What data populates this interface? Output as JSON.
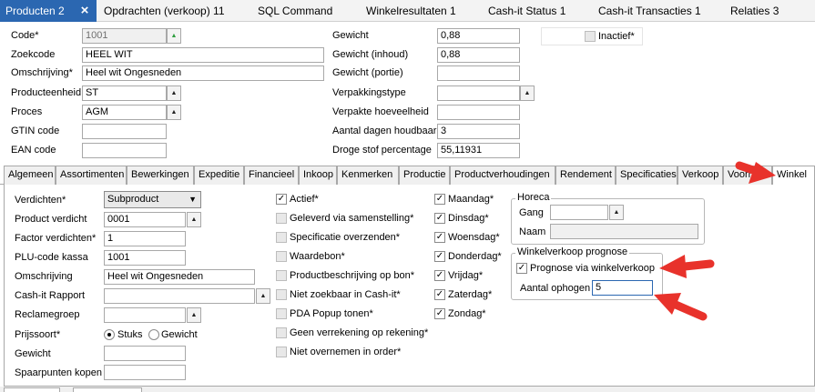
{
  "top_tabs": [
    {
      "label": "Producten 2",
      "active": true
    },
    {
      "label": "Opdrachten (verkoop) 11"
    },
    {
      "label": "SQL Command"
    },
    {
      "label": "Winkelresultaten 1"
    },
    {
      "label": "Cash-it Status 1"
    },
    {
      "label": "Cash-it Transacties 1"
    },
    {
      "label": "Relaties 3"
    }
  ],
  "close_icon": "×",
  "form": {
    "code": {
      "label": "Code*",
      "value": "1001"
    },
    "zoekcode": {
      "label": "Zoekcode",
      "value": "HEEL WIT"
    },
    "omschrijving": {
      "label": "Omschrijving*",
      "value": "Heel wit Ongesneden"
    },
    "producteenheid": {
      "label": "Producteenheid",
      "value": "ST"
    },
    "proces": {
      "label": "Proces",
      "value": "AGM"
    },
    "gtin": {
      "label": "GTIN code",
      "value": ""
    },
    "ean": {
      "label": "EAN code",
      "value": ""
    },
    "gewicht": {
      "label": "Gewicht",
      "value": "0,88"
    },
    "gewicht_inhoud": {
      "label": "Gewicht (inhoud)",
      "value": "0,88"
    },
    "gewicht_portie": {
      "label": "Gewicht (portie)",
      "value": ""
    },
    "verpakkingstype": {
      "label": "Verpakkingstype",
      "value": ""
    },
    "verpakte_hoeveelheid": {
      "label": "Verpakte hoeveelheid",
      "value": ""
    },
    "houdbaar": {
      "label": "Aantal dagen houdbaar",
      "value": "3"
    },
    "droge_stof": {
      "label": "Droge stof percentage",
      "value": "55,11931"
    },
    "inactief": {
      "label": "Inactief*",
      "checked": false
    }
  },
  "sub_tabs": [
    "Algemeen",
    "Assortimenten",
    "Bewerkingen",
    "Expeditie",
    "Financieel",
    "Inkoop",
    "Kenmerken",
    "Productie",
    "Productverhoudingen",
    "Rendement",
    "Specificaties",
    "Verkoop",
    "Voorraad",
    "Winkel"
  ],
  "active_sub_tab": "Winkel",
  "winkel": {
    "verdichten": {
      "label": "Verdichten*",
      "value": "Subproduct"
    },
    "product_verdicht": {
      "label": "Product verdicht",
      "value": "0001"
    },
    "factor_verdichten": {
      "label": "Factor verdichten*",
      "value": "1"
    },
    "plu": {
      "label": "PLU-code kassa",
      "value": "1001"
    },
    "omschrijving": {
      "label": "Omschrijving",
      "value": "Heel wit Ongesneden"
    },
    "cashit_rapport": {
      "label": "Cash-it Rapport",
      "value": ""
    },
    "reclamegroep": {
      "label": "Reclamegroep",
      "value": ""
    },
    "prijssoort": {
      "label": "Prijssoort*",
      "option_stuks": "Stuks",
      "option_gewicht": "Gewicht",
      "selected": "Stuks"
    },
    "gewicht": {
      "label": "Gewicht",
      "value": ""
    },
    "spaarpunten": {
      "label": "Spaarpunten kopen",
      "value": ""
    },
    "checks": [
      {
        "label": "Actief*",
        "checked": true,
        "enabled": true
      },
      {
        "label": "Geleverd via samenstelling*",
        "checked": false,
        "enabled": false
      },
      {
        "label": "Specificatie overzenden*",
        "checked": false,
        "enabled": false
      },
      {
        "label": "Waardebon*",
        "checked": false,
        "enabled": false
      },
      {
        "label": "Productbeschrijving op bon*",
        "checked": false,
        "enabled": false
      },
      {
        "label": "Niet zoekbaar in Cash-it*",
        "checked": false,
        "enabled": false
      },
      {
        "label": "PDA Popup tonen*",
        "checked": false,
        "enabled": false
      },
      {
        "label": "Geen verrekening op rekening*",
        "checked": false,
        "enabled": false
      },
      {
        "label": "Niet overnemen in order*",
        "checked": false,
        "enabled": false
      }
    ],
    "days": [
      {
        "label": "Maandag*",
        "checked": true
      },
      {
        "label": "Dinsdag*",
        "checked": true
      },
      {
        "label": "Woensdag*",
        "checked": true
      },
      {
        "label": "Donderdag*",
        "checked": true
      },
      {
        "label": "Vrijdag*",
        "checked": true
      },
      {
        "label": "Zaterdag*",
        "checked": true
      },
      {
        "label": "Zondag*",
        "checked": true
      }
    ],
    "horeca": {
      "title": "Horeca",
      "gang_label": "Gang",
      "gang_value": "",
      "naam_label": "Naam",
      "naam_value": ""
    },
    "prognose": {
      "title": "Winkelverkoop prognose",
      "check_label": "Prognose via winkelverkoop",
      "checked": true,
      "ophogen_label": "Aantal ophogen",
      "ophogen_value": "5"
    }
  },
  "colors": {
    "accent": "#2b67b1",
    "arrow": "#e8322b"
  }
}
